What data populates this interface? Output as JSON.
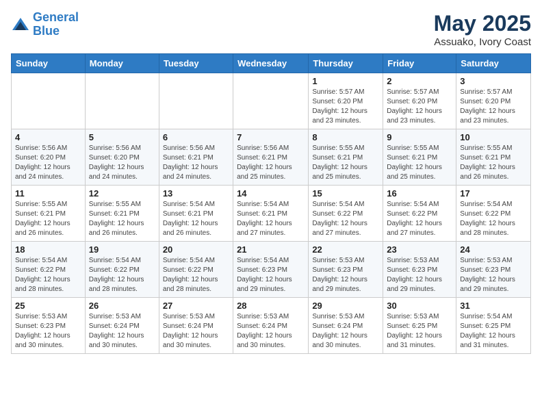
{
  "header": {
    "logo_line1": "General",
    "logo_line2": "Blue",
    "month_year": "May 2025",
    "location": "Assuako, Ivory Coast"
  },
  "weekdays": [
    "Sunday",
    "Monday",
    "Tuesday",
    "Wednesday",
    "Thursday",
    "Friday",
    "Saturday"
  ],
  "weeks": [
    [
      {
        "day": "",
        "info": ""
      },
      {
        "day": "",
        "info": ""
      },
      {
        "day": "",
        "info": ""
      },
      {
        "day": "",
        "info": ""
      },
      {
        "day": "1",
        "info": "Sunrise: 5:57 AM\nSunset: 6:20 PM\nDaylight: 12 hours\nand 23 minutes."
      },
      {
        "day": "2",
        "info": "Sunrise: 5:57 AM\nSunset: 6:20 PM\nDaylight: 12 hours\nand 23 minutes."
      },
      {
        "day": "3",
        "info": "Sunrise: 5:57 AM\nSunset: 6:20 PM\nDaylight: 12 hours\nand 23 minutes."
      }
    ],
    [
      {
        "day": "4",
        "info": "Sunrise: 5:56 AM\nSunset: 6:20 PM\nDaylight: 12 hours\nand 24 minutes."
      },
      {
        "day": "5",
        "info": "Sunrise: 5:56 AM\nSunset: 6:20 PM\nDaylight: 12 hours\nand 24 minutes."
      },
      {
        "day": "6",
        "info": "Sunrise: 5:56 AM\nSunset: 6:21 PM\nDaylight: 12 hours\nand 24 minutes."
      },
      {
        "day": "7",
        "info": "Sunrise: 5:56 AM\nSunset: 6:21 PM\nDaylight: 12 hours\nand 25 minutes."
      },
      {
        "day": "8",
        "info": "Sunrise: 5:55 AM\nSunset: 6:21 PM\nDaylight: 12 hours\nand 25 minutes."
      },
      {
        "day": "9",
        "info": "Sunrise: 5:55 AM\nSunset: 6:21 PM\nDaylight: 12 hours\nand 25 minutes."
      },
      {
        "day": "10",
        "info": "Sunrise: 5:55 AM\nSunset: 6:21 PM\nDaylight: 12 hours\nand 26 minutes."
      }
    ],
    [
      {
        "day": "11",
        "info": "Sunrise: 5:55 AM\nSunset: 6:21 PM\nDaylight: 12 hours\nand 26 minutes."
      },
      {
        "day": "12",
        "info": "Sunrise: 5:55 AM\nSunset: 6:21 PM\nDaylight: 12 hours\nand 26 minutes."
      },
      {
        "day": "13",
        "info": "Sunrise: 5:54 AM\nSunset: 6:21 PM\nDaylight: 12 hours\nand 26 minutes."
      },
      {
        "day": "14",
        "info": "Sunrise: 5:54 AM\nSunset: 6:21 PM\nDaylight: 12 hours\nand 27 minutes."
      },
      {
        "day": "15",
        "info": "Sunrise: 5:54 AM\nSunset: 6:22 PM\nDaylight: 12 hours\nand 27 minutes."
      },
      {
        "day": "16",
        "info": "Sunrise: 5:54 AM\nSunset: 6:22 PM\nDaylight: 12 hours\nand 27 minutes."
      },
      {
        "day": "17",
        "info": "Sunrise: 5:54 AM\nSunset: 6:22 PM\nDaylight: 12 hours\nand 28 minutes."
      }
    ],
    [
      {
        "day": "18",
        "info": "Sunrise: 5:54 AM\nSunset: 6:22 PM\nDaylight: 12 hours\nand 28 minutes."
      },
      {
        "day": "19",
        "info": "Sunrise: 5:54 AM\nSunset: 6:22 PM\nDaylight: 12 hours\nand 28 minutes."
      },
      {
        "day": "20",
        "info": "Sunrise: 5:54 AM\nSunset: 6:22 PM\nDaylight: 12 hours\nand 28 minutes."
      },
      {
        "day": "21",
        "info": "Sunrise: 5:54 AM\nSunset: 6:23 PM\nDaylight: 12 hours\nand 29 minutes."
      },
      {
        "day": "22",
        "info": "Sunrise: 5:53 AM\nSunset: 6:23 PM\nDaylight: 12 hours\nand 29 minutes."
      },
      {
        "day": "23",
        "info": "Sunrise: 5:53 AM\nSunset: 6:23 PM\nDaylight: 12 hours\nand 29 minutes."
      },
      {
        "day": "24",
        "info": "Sunrise: 5:53 AM\nSunset: 6:23 PM\nDaylight: 12 hours\nand 29 minutes."
      }
    ],
    [
      {
        "day": "25",
        "info": "Sunrise: 5:53 AM\nSunset: 6:23 PM\nDaylight: 12 hours\nand 30 minutes."
      },
      {
        "day": "26",
        "info": "Sunrise: 5:53 AM\nSunset: 6:24 PM\nDaylight: 12 hours\nand 30 minutes."
      },
      {
        "day": "27",
        "info": "Sunrise: 5:53 AM\nSunset: 6:24 PM\nDaylight: 12 hours\nand 30 minutes."
      },
      {
        "day": "28",
        "info": "Sunrise: 5:53 AM\nSunset: 6:24 PM\nDaylight: 12 hours\nand 30 minutes."
      },
      {
        "day": "29",
        "info": "Sunrise: 5:53 AM\nSunset: 6:24 PM\nDaylight: 12 hours\nand 30 minutes."
      },
      {
        "day": "30",
        "info": "Sunrise: 5:53 AM\nSunset: 6:25 PM\nDaylight: 12 hours\nand 31 minutes."
      },
      {
        "day": "31",
        "info": "Sunrise: 5:54 AM\nSunset: 6:25 PM\nDaylight: 12 hours\nand 31 minutes."
      }
    ]
  ]
}
